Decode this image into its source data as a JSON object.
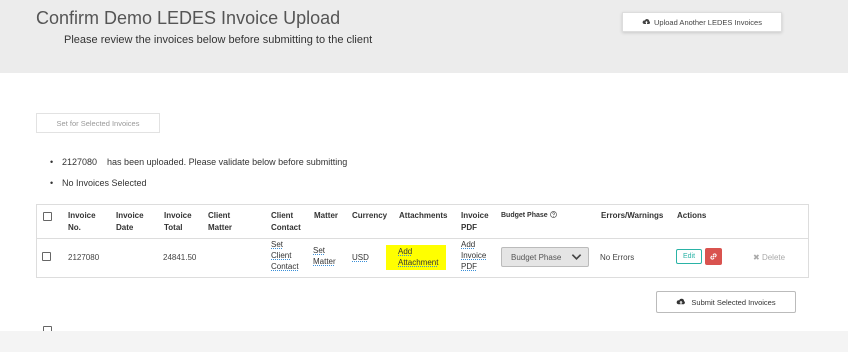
{
  "header": {
    "title": "Confirm Demo LEDES Invoice Upload",
    "subtitle": "Please review the invoices below before submitting to the client",
    "upload_button": "Upload Another LEDES Invoices"
  },
  "set_selected_button": "Set for Selected Invoices",
  "messages": {
    "invoice_number": "2127080",
    "uploaded_text": "has been uploaded. Please validate below before submitting",
    "no_selection": "No Invoices Selected"
  },
  "table": {
    "headers": {
      "invoice_no": [
        "Invoice",
        "No."
      ],
      "invoice_date": [
        "Invoice",
        "Date"
      ],
      "invoice_total": [
        "Invoice",
        "Total"
      ],
      "client_matter": [
        "Client",
        "Matter"
      ],
      "client_contact": [
        "Client",
        "Contact"
      ],
      "matter": "Matter",
      "currency": "Currency",
      "attachments": "Attachments",
      "invoice_pdf": [
        "Invoice",
        "PDF"
      ],
      "budget_phase": "Budget Phase",
      "errors": "Errors/Warnings",
      "actions": "Actions"
    },
    "row": {
      "invoice_no": "2127080",
      "invoice_total": "24841.50",
      "client_contact": [
        "Set",
        "Client",
        "Contact"
      ],
      "matter": [
        "Set",
        "Matter"
      ],
      "currency": "USD",
      "attachment": [
        "Add",
        "Attachment"
      ],
      "invoice_pdf": [
        "Add",
        "Invoice",
        "PDF"
      ],
      "budget_phase_value": "Budget Phase",
      "errors": "No Errors",
      "edit": "Edit",
      "delete": "Delete"
    }
  },
  "submit_button": "Submit Selected Invoices",
  "colors": {
    "highlight": "#ffff00",
    "edit_accent": "#2ab3a6",
    "danger": "#d9534f",
    "link_underline": "#3a8fd8"
  },
  "icons": {
    "upload": "cloud-upload-icon",
    "help": "help-circle-icon",
    "chevron": "chevron-down-icon",
    "link": "link-icon",
    "delete": "close-icon",
    "submit": "cloud-upload-icon"
  }
}
